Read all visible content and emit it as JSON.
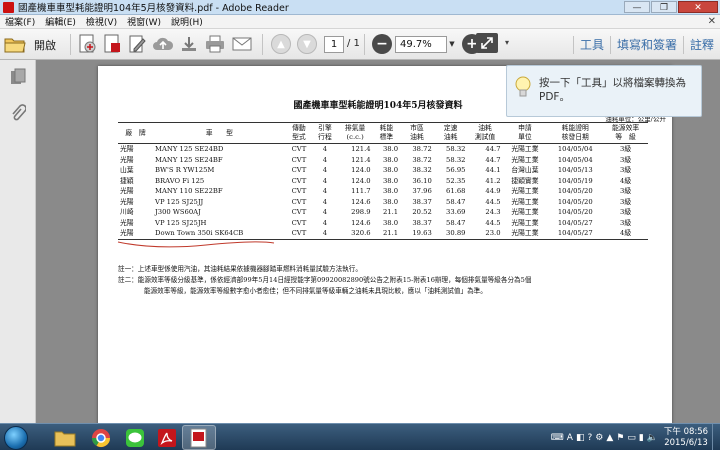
{
  "window": {
    "title": "國產機車車型耗能證明104年5月核發資料.pdf - Adobe Reader",
    "controls": [
      "—",
      "❐",
      "✕"
    ]
  },
  "menu": {
    "items": [
      "檔案(F)",
      "編輯(E)",
      "檢視(V)",
      "視窗(W)",
      "說明(H)"
    ],
    "close_doc": "✕"
  },
  "toolbar": {
    "open_label": "開啟",
    "page_current": "1",
    "page_total": "/ 1",
    "zoom": "49.7%",
    "zoom_minus": "−",
    "zoom_plus": "+",
    "panes": [
      "工具",
      "填寫和簽署",
      "註釋"
    ]
  },
  "tooltip": {
    "text": "按一下「工具」以將檔案轉換為 PDF。"
  },
  "document": {
    "title": "國產機車車型耗能證明104年5月核發資料",
    "unit_note": "油耗單位：公里/公升",
    "headers": [
      [
        "廠　牌",
        ""
      ],
      [
        "車　　型",
        ""
      ],
      [
        "傳動",
        "型式"
      ],
      [
        "引擎",
        "行程"
      ],
      [
        "排氣量",
        "(c.c.)"
      ],
      [
        "耗能",
        "標準"
      ],
      [
        "市區",
        "油耗"
      ],
      [
        "定速",
        "油耗"
      ],
      [
        "油耗",
        "測試值"
      ],
      [
        "申請",
        "單位"
      ],
      [
        "耗能證明",
        "核發日期"
      ],
      [
        "能源效率",
        "等　級"
      ]
    ],
    "rows": [
      [
        "光陽",
        "MANY 125 SE24BD",
        "CVT",
        "4",
        "121.4",
        "38.0",
        "38.72",
        "58.32",
        "44.7",
        "光陽工業",
        "104/05/04",
        "3級"
      ],
      [
        "光陽",
        "MANY 125 SE24BF",
        "CVT",
        "4",
        "121.4",
        "38.0",
        "38.72",
        "58.32",
        "44.7",
        "光陽工業",
        "104/05/04",
        "3級"
      ],
      [
        "山葉",
        "BW'S R YW125M",
        "CVT",
        "4",
        "124.0",
        "38.0",
        "38.32",
        "56.95",
        "44.1",
        "台灣山葉",
        "104/05/13",
        "3級"
      ],
      [
        "捷穎",
        "BRAVO Fi 125",
        "CVT",
        "4",
        "124.0",
        "38.0",
        "36.10",
        "52.35",
        "41.2",
        "捷穎實業",
        "104/05/19",
        "4級"
      ],
      [
        "光陽",
        "MANY 110 SE22BF",
        "CVT",
        "4",
        "111.7",
        "38.0",
        "37.96",
        "61.68",
        "44.9",
        "光陽工業",
        "104/05/20",
        "3級"
      ],
      [
        "光陽",
        "VP 125 SJ25JJ",
        "CVT",
        "4",
        "124.6",
        "38.0",
        "38.37",
        "58.47",
        "44.5",
        "光陽工業",
        "104/05/20",
        "3級"
      ],
      [
        "川崎",
        "J300 WS60AJ",
        "CVT",
        "4",
        "298.9",
        "21.1",
        "20.52",
        "33.69",
        "24.3",
        "光陽工業",
        "104/05/20",
        "3級"
      ],
      [
        "光陽",
        "VP 125 SJ25JH",
        "CVT",
        "4",
        "124.6",
        "38.0",
        "38.37",
        "58.47",
        "44.5",
        "光陽工業",
        "104/05/27",
        "3級"
      ],
      [
        "光陽",
        "Down Town 350i SK64CB",
        "CVT",
        "4",
        "320.6",
        "21.1",
        "19.63",
        "30.89",
        "23.0",
        "光陽工業",
        "104/05/27",
        "4級"
      ]
    ],
    "note1": "註一：上述車型係使用汽油，其油耗結果依據機器腳踏車燃料消耗量試驗方法執行。",
    "note2a": "註二：能源效率等級分級基準，係依經濟部99年5月14日經授能字第09920082890號公告之附表15-附表16辦理，每個排氣量等級各分為5個",
    "note2b": "能源效率等級，能源效率等級數字愈小者愈佳；但不同排氣量等級車輛之油耗未具現比較，應以「油耗測試值」為準。"
  },
  "taskbar": {
    "lang": "A",
    "time": "下午 08:56",
    "date": "2015/6/13"
  },
  "colors": {
    "acrobat_red": "#c4161c",
    "pane_blue": "#3a6ea8",
    "annotation_red": "#c0392b"
  }
}
